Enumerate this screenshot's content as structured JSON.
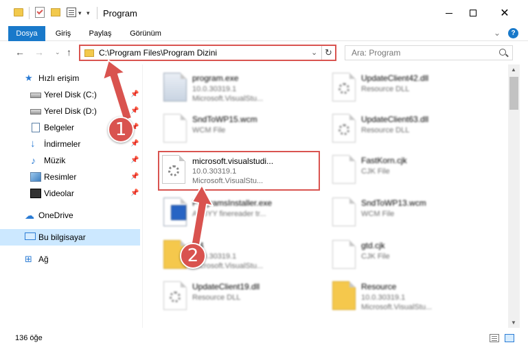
{
  "window": {
    "title": "Program",
    "qa_dropdown_glyph": "▾",
    "min_label": "",
    "close_glyph": "✕"
  },
  "ribbon": {
    "tabs": [
      "Dosya",
      "Giriş",
      "Paylaş",
      "Görünüm"
    ],
    "active_tab": "Dosya",
    "help_glyph": "?",
    "collapse_glyph": "⌄"
  },
  "nav": {
    "back_glyph": "←",
    "forward_glyph": "→",
    "recent_glyph": "⌄",
    "up_glyph": "↑",
    "address": "C:\\Program Files\\Program Dizini",
    "address_dd_glyph": "⌄",
    "refresh_glyph": "↻",
    "search_placeholder": "Ara: Program"
  },
  "sidebar": {
    "pin_glyph": "📌",
    "items": [
      {
        "label": "Hızlı erişim",
        "icon": "star-icon",
        "glyph": "★"
      },
      {
        "label": "Yerel Disk (C:)",
        "icon": "drive-icon"
      },
      {
        "label": "Yerel Disk (D:)",
        "icon": "drive-icon"
      },
      {
        "label": "Belgeler",
        "icon": "documents-icon"
      },
      {
        "label": "İndirmeler",
        "icon": "downloads-icon",
        "glyph": "↓"
      },
      {
        "label": "Müzik",
        "icon": "music-icon",
        "glyph": "♪"
      },
      {
        "label": "Resimler",
        "icon": "pictures-icon"
      },
      {
        "label": "Videolar",
        "icon": "videos-icon"
      },
      {
        "label": "OneDrive",
        "icon": "cloud-icon",
        "glyph": "☁"
      },
      {
        "label": "Bu bilgisayar",
        "icon": "pc-icon",
        "selected": true
      },
      {
        "label": "Ağ",
        "icon": "network-icon",
        "glyph": "⊞"
      }
    ]
  },
  "files": [
    {
      "name": "program.exe",
      "line2": "10.0.30319.1",
      "line3": "Microsoft.VisualStu...",
      "icon": "exe-file-icon"
    },
    {
      "name": "UpdateClient42.dll",
      "line2": "Resource DLL",
      "line3": "",
      "icon": "dll-file-icon"
    },
    {
      "name": "SndToWP15.wcm",
      "line2": "WCM File",
      "line3": "",
      "icon": "generic-file-icon"
    },
    {
      "name": "UpdateClient63.dll",
      "line2": "Resource DLL",
      "line3": "",
      "icon": "dll-file-icon"
    },
    {
      "name": "microsoft.visualstudi...",
      "line2": "10.0.30319.1",
      "line3": "Microsoft.VisualStu...",
      "icon": "dll-file-icon",
      "highlighted": true
    },
    {
      "name": "FastKorn.cjk",
      "line2": "CJK File",
      "line3": "",
      "icon": "generic-file-icon"
    },
    {
      "name": "ProgramsInstaller.exe",
      "line2": "ABBYY finereader tr...",
      "line3": "",
      "icon": "installer-file-icon"
    },
    {
      "name": "SndToWP13.wcm",
      "line2": "WCM File",
      "line3": "",
      "icon": "generic-file-icon"
    },
    {
      "name": "...4",
      "line2": "10.0.30319.1",
      "line3": "Microsoft.VisualStu...",
      "icon": "folder-file-icon"
    },
    {
      "name": "gtd.cjk",
      "line2": "CJK File",
      "line3": "",
      "icon": "generic-file-icon"
    },
    {
      "name": "UpdateClient19.dll",
      "line2": "Resource DLL",
      "line3": "",
      "icon": "dll-file-icon"
    },
    {
      "name": "Resource",
      "line2": "10.0.30319.1",
      "line3": "Microsoft.VisualStu...",
      "icon": "folder-icon"
    }
  ],
  "status": {
    "item_count": "136 öğe"
  },
  "callouts": [
    {
      "number": "1"
    },
    {
      "number": "2"
    }
  ],
  "colors": {
    "accent": "#1979ca",
    "highlight_red": "#d9534f",
    "selection": "#cce8ff"
  }
}
